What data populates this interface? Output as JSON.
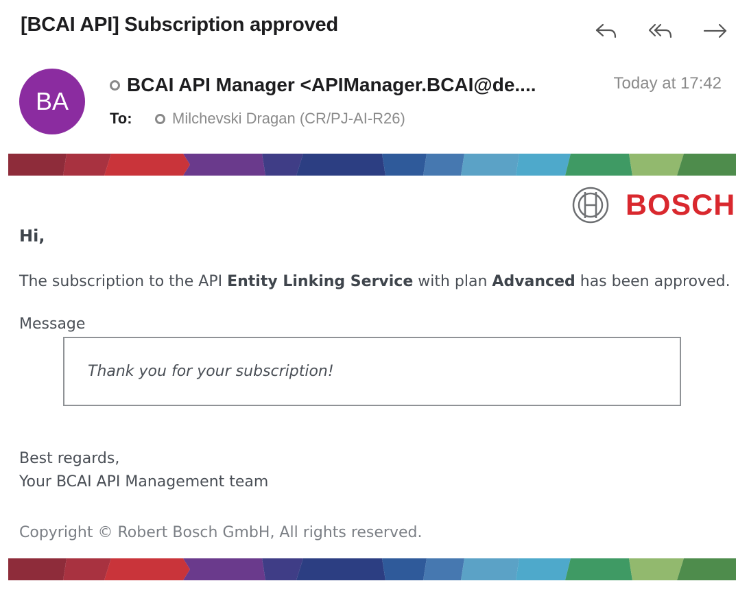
{
  "email": {
    "subject": "[BCAI API] Subscription approved",
    "avatar_initials": "BA",
    "avatar_color": "#8b2ca0",
    "sender": "BCAI API Manager <APIManager.BCAI@de....",
    "date": "Today at 17:42",
    "to_label": "To:",
    "recipient": "Milchevski Dragan (CR/PJ-AI-R26)"
  },
  "toolbar": {
    "reply_icon": "reply-icon",
    "reply_all_icon": "reply-all-icon",
    "forward_icon": "forward-icon"
  },
  "brand": {
    "logo_text": "BOSCH",
    "logo_color": "#d9282e"
  },
  "content": {
    "greeting": "Hi,",
    "line_prefix": "The subscription to the API ",
    "api_name": "Entity Linking Service",
    "line_middle": " with plan ",
    "plan_name": "Advanced",
    "line_suffix": " has been approved.",
    "message_label": "Message",
    "message": "Thank you for your subscription!",
    "regards": "Best regards,",
    "team": "Your BCAI API Management team",
    "copyright": "Copyright © Robert Bosch GmbH, All rights reserved."
  }
}
